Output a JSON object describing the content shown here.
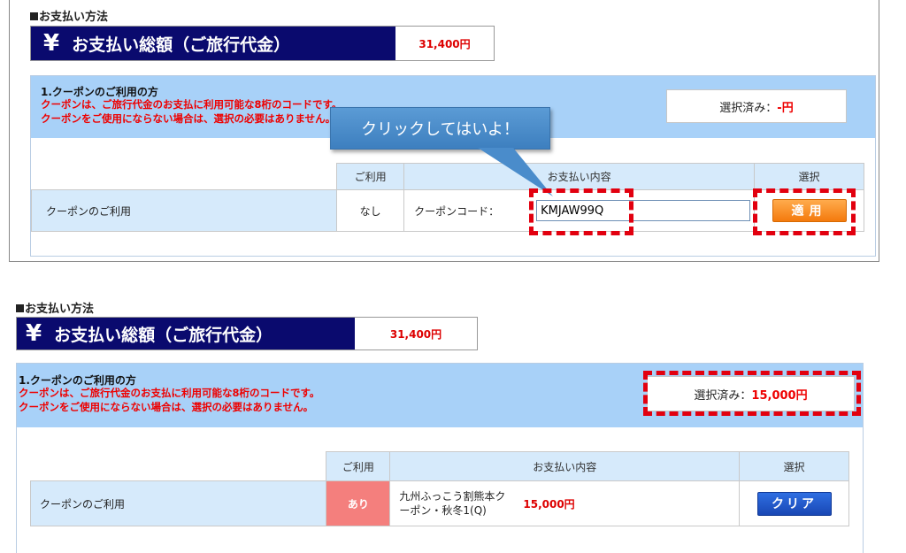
{
  "top": {
    "heading": "お支払い方法",
    "total": {
      "yen_symbol": "¥",
      "label": "お支払い総額（ご旅行代金）",
      "value": "31,400円"
    },
    "coupon": {
      "title": "1.クーポンのご利用の方",
      "notice_line1": "クーポンは、ご旅行代金のお支払に利用可能な8桁のコードです。",
      "notice_line2": "クーポンをご使用にならない場合は、選択の必要はありません。",
      "selected_prefix": "選択済み：",
      "selected_value": "-円",
      "table": {
        "headers": {
          "use": "ご利用",
          "content": "お支払い内容",
          "select": "選択"
        },
        "row": {
          "name": "クーポンのご利用",
          "use": "なし",
          "code_label": "クーポンコード：",
          "code_value": "KMJAW99Q",
          "button": "適用"
        }
      }
    },
    "callout": "クリックしてはいよ！"
  },
  "bottom": {
    "heading": "お支払い方法",
    "total": {
      "yen_symbol": "¥",
      "label": "お支払い総額（ご旅行代金）",
      "value": "31,400円"
    },
    "coupon": {
      "title": "1.クーポンのご利用の方",
      "notice_line1": "クーポンは、ご旅行代金のお支払に利用可能な8桁のコードです。",
      "notice_line2": "クーポンをご使用にならない場合は、選択の必要はありません。",
      "selected_prefix": "選択済み：",
      "selected_value": "15,000円",
      "table": {
        "headers": {
          "use": "ご利用",
          "content": "お支払い内容",
          "select": "選択"
        },
        "row": {
          "name": "クーポンのご利用",
          "use": "あり",
          "coupon_name_line1": "九州ふっこう割熊本ク",
          "coupon_name_line2": "ーポン・秋冬1(Q)",
          "amount": "15,000円",
          "button": "クリア"
        }
      }
    }
  },
  "colors": {
    "accent_navy": "#0a0a6e",
    "header_blue": "#a8d1f8",
    "alert_red": "#e00000",
    "apply_orange": "#f47a0d",
    "clear_blue": "#1947b4"
  }
}
